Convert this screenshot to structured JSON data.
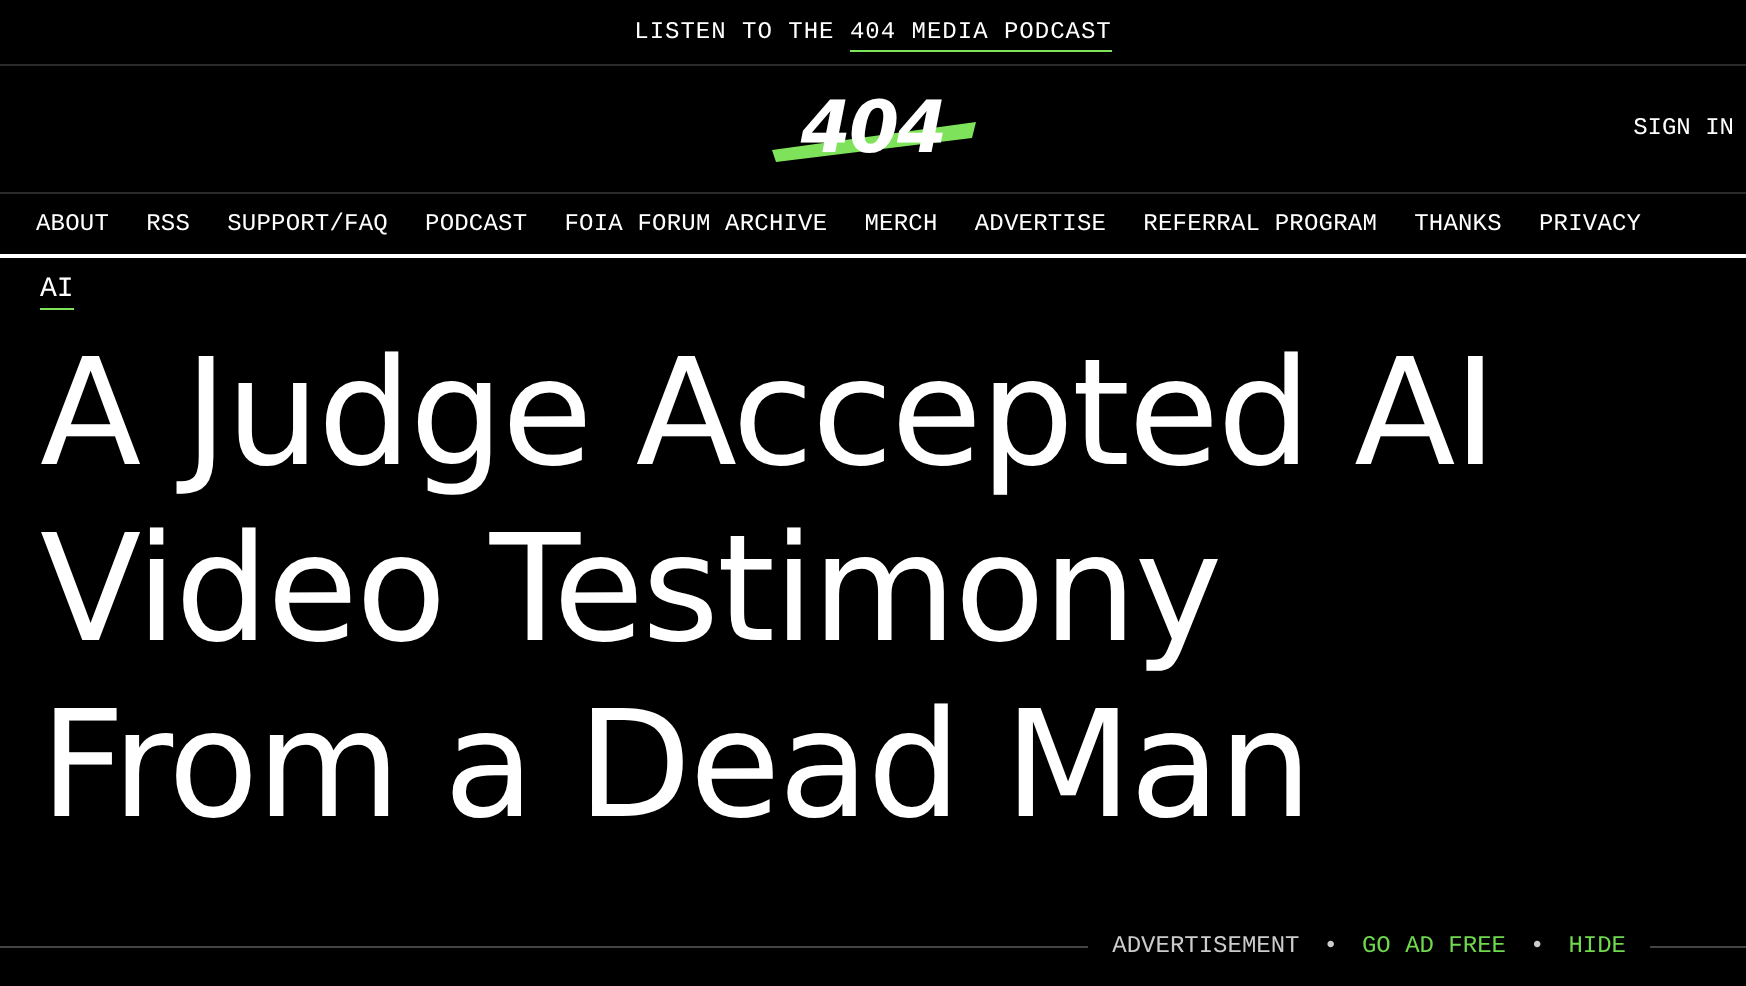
{
  "promo_bar": {
    "text": "LISTEN TO THE ",
    "link": "404 MEDIA PODCAST"
  },
  "header": {
    "logo": "404",
    "sign_in": "SIGN IN"
  },
  "nav": {
    "items": [
      "ABOUT",
      "RSS",
      "SUPPORT/FAQ",
      "PODCAST",
      "FOIA FORUM ARCHIVE",
      "MERCH",
      "ADVERTISE",
      "REFERRAL PROGRAM",
      "THANKS",
      "PRIVACY"
    ]
  },
  "article": {
    "tag": "AI",
    "title": "A Judge Accepted AI Video Testimony From a Dead Man"
  },
  "ad_bar": {
    "label": "ADVERTISEMENT",
    "separator_1": "•",
    "go_ad_free": "GO AD FREE",
    "separator_2": "•",
    "hide": "HIDE"
  }
}
